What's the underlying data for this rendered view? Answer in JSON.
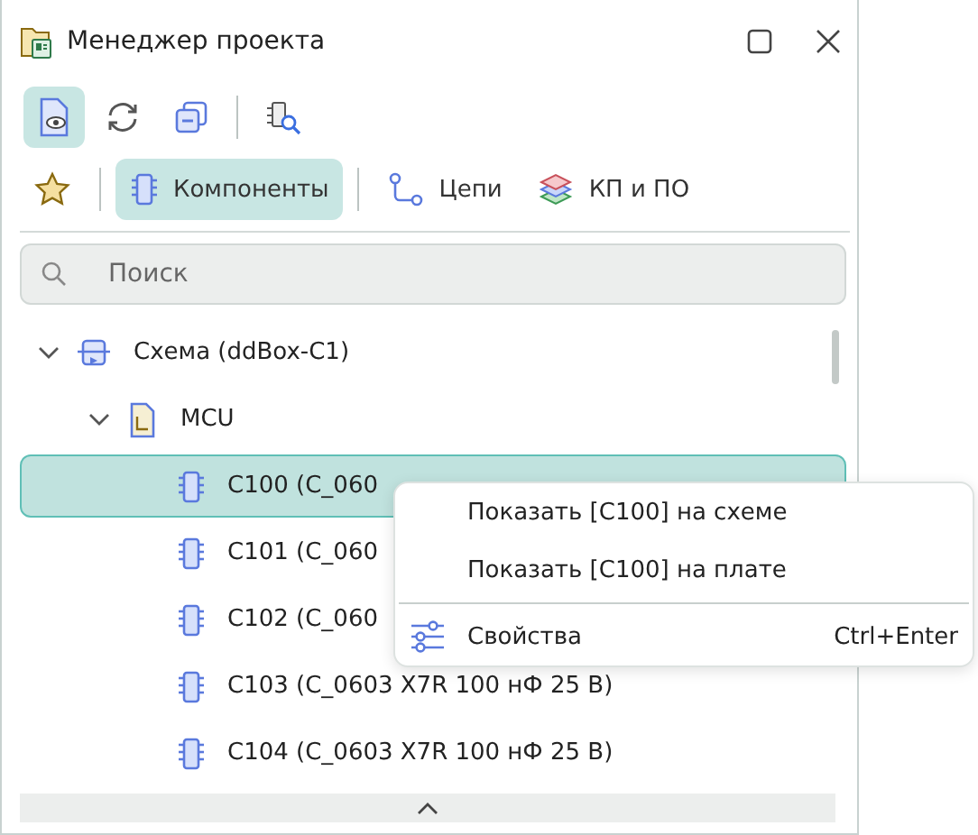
{
  "window": {
    "title": "Менеджер проекта"
  },
  "toolbar": [
    {
      "kind": "preview",
      "selected": true
    },
    {
      "kind": "refresh",
      "selected": false
    },
    {
      "kind": "collapse",
      "selected": false
    },
    {
      "kind": "separator"
    },
    {
      "kind": "find",
      "selected": false
    }
  ],
  "tabs": [
    {
      "kind": "favorites",
      "selected": false
    },
    {
      "kind": "components",
      "label": "Компоненты",
      "selected": true
    },
    {
      "kind": "nets",
      "label": "Цепи",
      "selected": false
    },
    {
      "kind": "pads",
      "label": "КП и ПО",
      "selected": false
    }
  ],
  "search": {
    "placeholder": "Поиск"
  },
  "tree": [
    {
      "kind": "schematic",
      "label": "Схема (ddBox-C1)",
      "expanded": true,
      "selected": false,
      "children": [
        {
          "kind": "sheet",
          "label": "MCU",
          "expanded": true,
          "selected": false,
          "children": [
            {
              "kind": "component",
              "label": "C100 (C_060",
              "selected": true
            },
            {
              "kind": "component",
              "label": "C101 (C_060",
              "selected": false
            },
            {
              "kind": "component",
              "label": "C102 (C_060",
              "selected": false
            },
            {
              "kind": "component",
              "label": "C103 (C_0603 X7R 100 нФ 25 В)",
              "selected": false
            },
            {
              "kind": "component",
              "label": "C104 (C_0603 X7R 100 нФ 25 В)",
              "selected": false
            }
          ]
        }
      ]
    }
  ],
  "context_menu": [
    {
      "kind": "item",
      "label": "Показать [C100] на схеме"
    },
    {
      "kind": "item",
      "label": "Показать [C100] на плате"
    },
    {
      "kind": "separator"
    },
    {
      "kind": "properties",
      "label": "Свойства",
      "shortcut": "Ctrl+Enter"
    }
  ]
}
